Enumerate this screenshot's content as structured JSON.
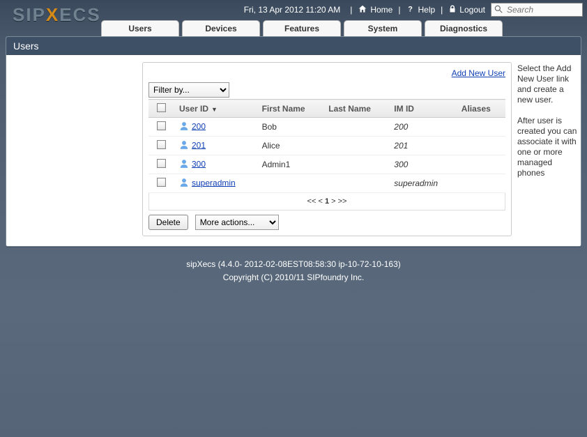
{
  "header": {
    "datetime": "Fri, 13 Apr 2012 11:20 AM",
    "home": "Home",
    "help": "Help",
    "logout": "Logout",
    "search_placeholder": "Search"
  },
  "logo": {
    "pre": "SIP",
    "mid": "X",
    "post": "ECS"
  },
  "tabs": [
    "Users",
    "Devices",
    "Features",
    "System",
    "Diagnostics"
  ],
  "panel": {
    "title": "Users"
  },
  "content": {
    "add_new_user": "Add New User",
    "filter_label": "Filter by...",
    "columns": {
      "user_id": "User ID",
      "first_name": "First Name",
      "last_name": "Last Name",
      "im_id": "IM ID",
      "aliases": "Aliases"
    },
    "rows": [
      {
        "user_id": "200",
        "first_name": "Bob",
        "last_name": "",
        "im_id": "200",
        "aliases": ""
      },
      {
        "user_id": "201",
        "first_name": "Alice",
        "last_name": "",
        "im_id": "201",
        "aliases": ""
      },
      {
        "user_id": "300",
        "first_name": "Admin1",
        "last_name": "",
        "im_id": "300",
        "aliases": ""
      },
      {
        "user_id": "superadmin",
        "first_name": "",
        "last_name": "",
        "im_id": "superadmin",
        "aliases": ""
      }
    ],
    "pager": {
      "first": "<<",
      "prev": "<",
      "page": "1",
      "next": ">",
      "last": ">>"
    },
    "delete_label": "Delete",
    "more_actions_label": "More actions..."
  },
  "help": {
    "p1": "Select the Add New User link and create a new user.",
    "p2": "After user is created you can associate it with one or more managed phones"
  },
  "footer": {
    "line1": "sipXecs (4.4.0- 2012-02-08EST08:58:30 ip-10-72-10-163)",
    "line2": "Copyright (C) 2010/11 SIPfoundry Inc."
  }
}
